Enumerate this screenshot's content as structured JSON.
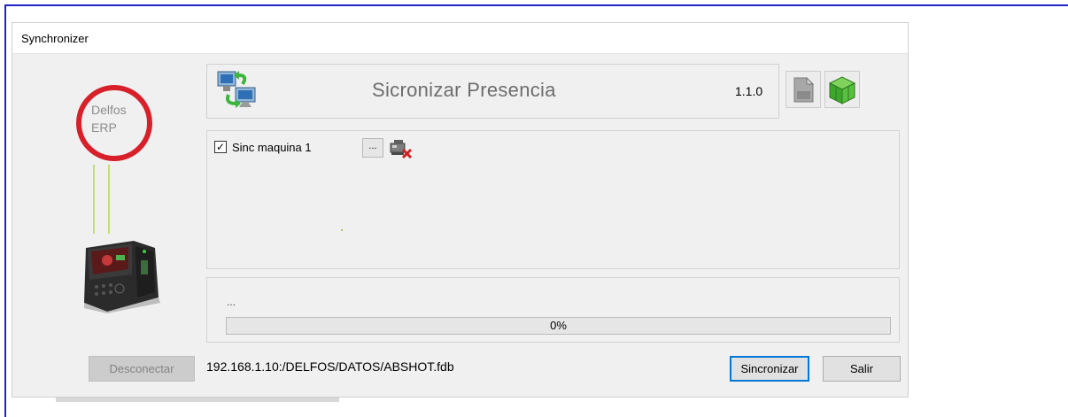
{
  "window": {
    "title": "Synchronizer"
  },
  "logo": {
    "line1": "Delfos",
    "line2": "ERP"
  },
  "header": {
    "title": "Sicronizar Presencia",
    "version": "1.1.0"
  },
  "toolbar": {
    "icons": [
      "document-icon",
      "package-icon"
    ]
  },
  "machines": [
    {
      "label": "Sinc maquina 1",
      "checked": true,
      "browse_label": "..."
    }
  ],
  "progress": {
    "status": "...",
    "value": 0,
    "label": "0%"
  },
  "footer": {
    "disconnect_label": "Desconectar",
    "db_path": "192.168.1.10:/DELFOS/DATOS/ABSHOT.fdb",
    "sync_label": "Sincronizar",
    "exit_label": "Salir"
  }
}
